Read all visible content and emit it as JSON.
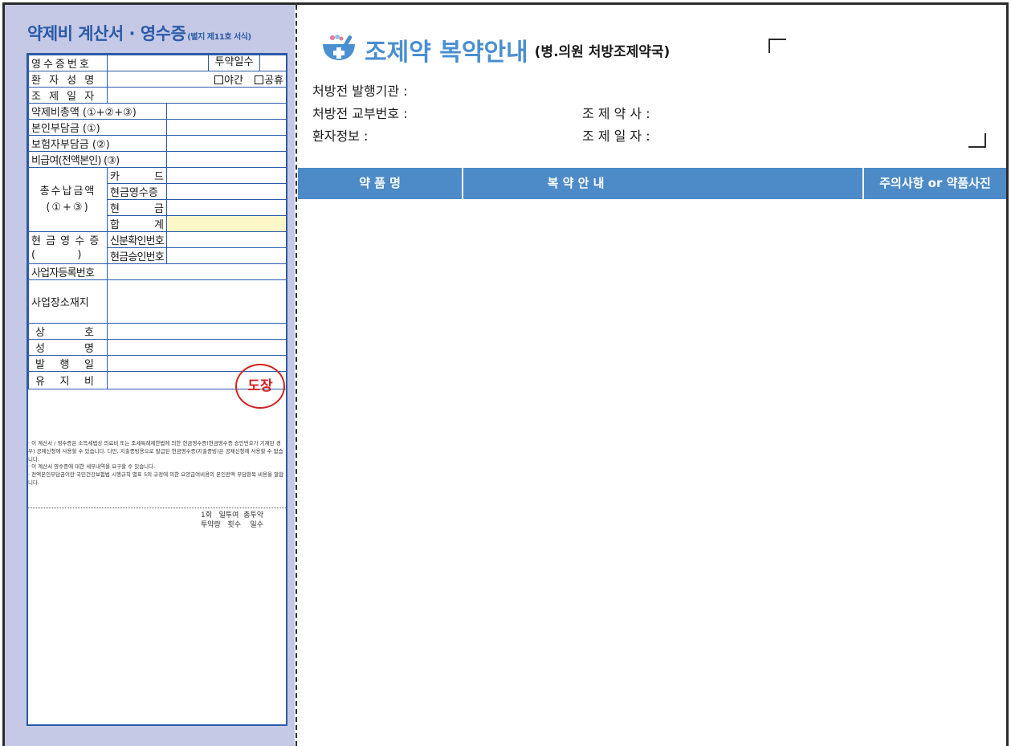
{
  "receipt": {
    "title": "약제비 계산서 · 영수증",
    "subtitle": "(별지 제11호 서식)",
    "receipt_no": "영수증번호",
    "dosing_days": "투약일수",
    "patient_name": "환 자 성 명",
    "night": "야간",
    "holiday": "공휴",
    "dispense_date": "조 제 일 자",
    "total_cost": "약제비총액 (①+②+③)",
    "patient_share": "본인부담금 (①)",
    "insurer_share": "보험자부담금 (②)",
    "non_covered": "비급여(전액본인) (③)",
    "total_paid": "총수납금액",
    "total_paid_formula": "(①+③)",
    "card": "카 드",
    "cash_receipt_pay": "현금영수증",
    "cash": "현 금",
    "sum": "합 계",
    "cash_receipt": "현 금 영 수 증",
    "cash_receipt_paren": "(          )",
    "id_no": "신분확인번호",
    "approval_no": "현금승인번호",
    "biz_reg_no": "사업자등록번호",
    "biz_address": "사업장소재지",
    "trade_name": "상 호",
    "name": "성 명",
    "issue_date": "발 행 일",
    "maintenance": "유 지 비",
    "seal": "도장"
  },
  "notes": [
    "· 이 계산서 / 영수증은 소득세법상 의료비 또는 조세특례제한법에 의한 현금영수증(현금영수증 승인번호가 기재된 경우) 공제신청에 사용할 수 있습니다. 다만, 지출증빙용으로 발급된 현금영수증(지출증빙)은 공제신청에 사용할 수 없습니다.",
    "· 이 계산서 영수증에 대한 세부내역을 요구할 수 있습니다.",
    "· 전액본인부담금이란 국민건강보험법 시행규칙 별표 5의 규정에 의한 요양급여비용의 본인전액 부담항목 비용을 말합니다."
  ],
  "dose_header": {
    "line1": "1회   일투여  총투약",
    "line2": "투약량   횟수    일수"
  },
  "guide": {
    "title": "조제약 복약안내",
    "subtitle": "(병.의원 처방조제약국)",
    "issuer": "처방전 발행기관 :",
    "rx_no": "처방전 교부번호 :",
    "pharmacist": "조 제 약 사 :",
    "patient_info": "환자정보 :",
    "dispense_date": "조 제 일 자 :"
  },
  "table_headers": {
    "drug_name": "약 품 명",
    "guide": "복 약 안 내",
    "caution": "주의사항 or 약품사진"
  },
  "colors": {
    "accent_blue": "#4c8bc8",
    "title_blue": "#4a8fd0",
    "panel_lavender": "#c5c9e6",
    "seal_red": "#d42020",
    "highlight_yellow": "#fdf7c8"
  }
}
